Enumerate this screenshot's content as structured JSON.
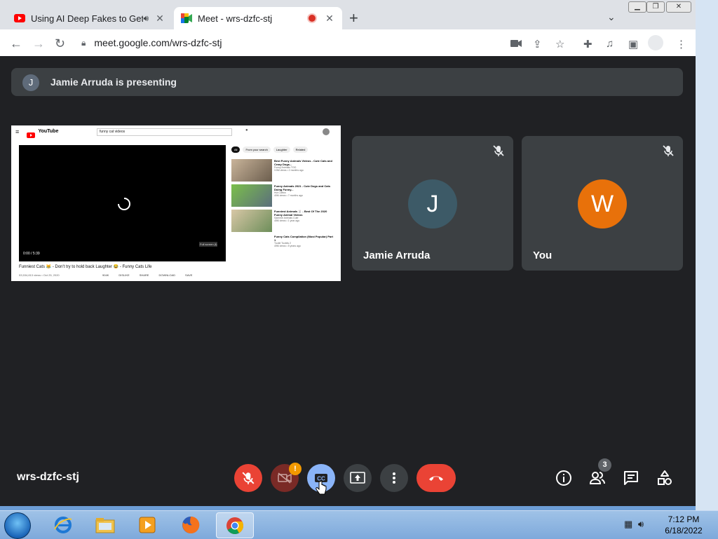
{
  "browser": {
    "tabs": [
      {
        "title": "Using AI Deep Fakes to Get F"
      },
      {
        "title": "Meet - wrs-dzfc-stj"
      }
    ],
    "url": "meet.google.com/wrs-dzfc-stj"
  },
  "meet": {
    "presenting_banner": "Jamie Arruda is presenting",
    "presenter_initial": "J",
    "participants": [
      {
        "initial": "J",
        "name": "Jamie Arruda",
        "color": "#3d5a67",
        "muted": true
      },
      {
        "initial": "W",
        "name": "You",
        "color": "#e8710a",
        "muted": true
      }
    ],
    "meeting_code": "wrs-dzfc-stj",
    "people_count": "3",
    "camera_alert": "!"
  },
  "shared_screen": {
    "search_query": "funny cat videos",
    "chips": [
      "All",
      "From your search",
      "Laughter",
      "Related"
    ],
    "video_title": "Funniest Cats 😹 - Don't try to hold back Laughter 😂 - Funny Cats Life",
    "video_meta": "53,534,813 views • Oct 25, 2020",
    "actions": [
      "904K",
      "DISLIKE",
      "SHARE",
      "DOWNLOAD",
      "SAVE"
    ],
    "player_time": "0:00 / 5:39",
    "fullscreen_tip": "Full screen (f)",
    "suggestions": [
      {
        "title": "Best Funny Animals Videos - Cute Cats and Crazy Dogs...",
        "channel": "Funny Animals TOO",
        "meta": "3.5M views • 2 months ago"
      },
      {
        "title": "Funny Animals 2021 - Cute Dogs and Cats Doing Funny...",
        "channel": "Hut Cattoo",
        "meta": "40M views • 7 months ago"
      },
      {
        "title": "Funniest Animals 🐰 - Best Of The 2020 Funny Animal Videos",
        "channel": "Sammie Animals Cute",
        "meta": "45M views • 1 year ago"
      },
      {
        "title": "Funny Cats Compilation (Most Popular) Part 1",
        "channel": "Tuckit Tuckits 2",
        "meta": "49M views • 5 years ago"
      }
    ]
  },
  "taskbar": {
    "time": "7:12 PM",
    "date": "6/18/2022"
  },
  "colors": {
    "meet_bg": "#202124",
    "surface": "#3c4043",
    "hangup": "#ea4335",
    "cc_active": "#8ab4f8"
  }
}
